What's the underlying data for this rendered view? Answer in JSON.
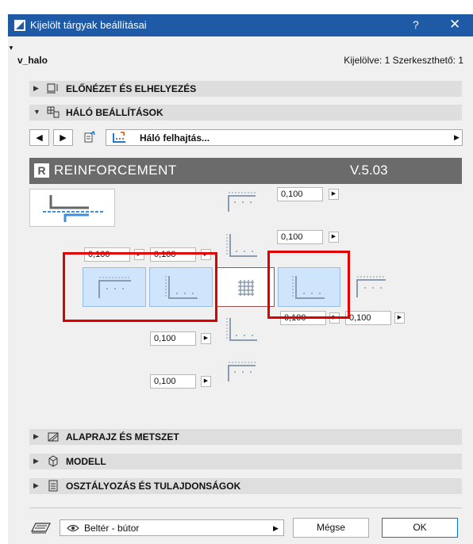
{
  "window": {
    "title": "Kijelölt tárgyak beállításai",
    "help": "?",
    "close": "✕"
  },
  "header": {
    "object_name": "v_halo",
    "selection_info": "Kijelölve: 1 Szerkeszthető: 1"
  },
  "sections": {
    "preview": "ELŐNÉZET ÉS ELHELYEZÉS",
    "mesh": "HÁLÓ BEÁLLÍTÁSOK",
    "floorplan": "ALAPRAJZ ÉS METSZET",
    "model": "MODELL",
    "classification": "OSZTÁLYOZÁS ÉS TULAJDONSÁGOK"
  },
  "toolbar": {
    "prev": "◀",
    "next": "▶",
    "dropdown_label": "Háló felhajtás..."
  },
  "reinforcement": {
    "title": "REINFORCEMENT",
    "version": "V.5.03",
    "logo_text": "R"
  },
  "values": {
    "top1": "0,100",
    "top2": "0,100",
    "left1": "0,100",
    "left2": "0,100",
    "right1": "0,100",
    "right2": "0,100",
    "bottom1": "0,100",
    "bottom2": "0,100"
  },
  "footer": {
    "favorite": "Beltér - bútor",
    "cancel": "Mégse",
    "ok": "OK"
  },
  "colors": {
    "titlebar": "#1f5aa6",
    "tile": "#cfe5fb",
    "highlight": "#e00000"
  }
}
